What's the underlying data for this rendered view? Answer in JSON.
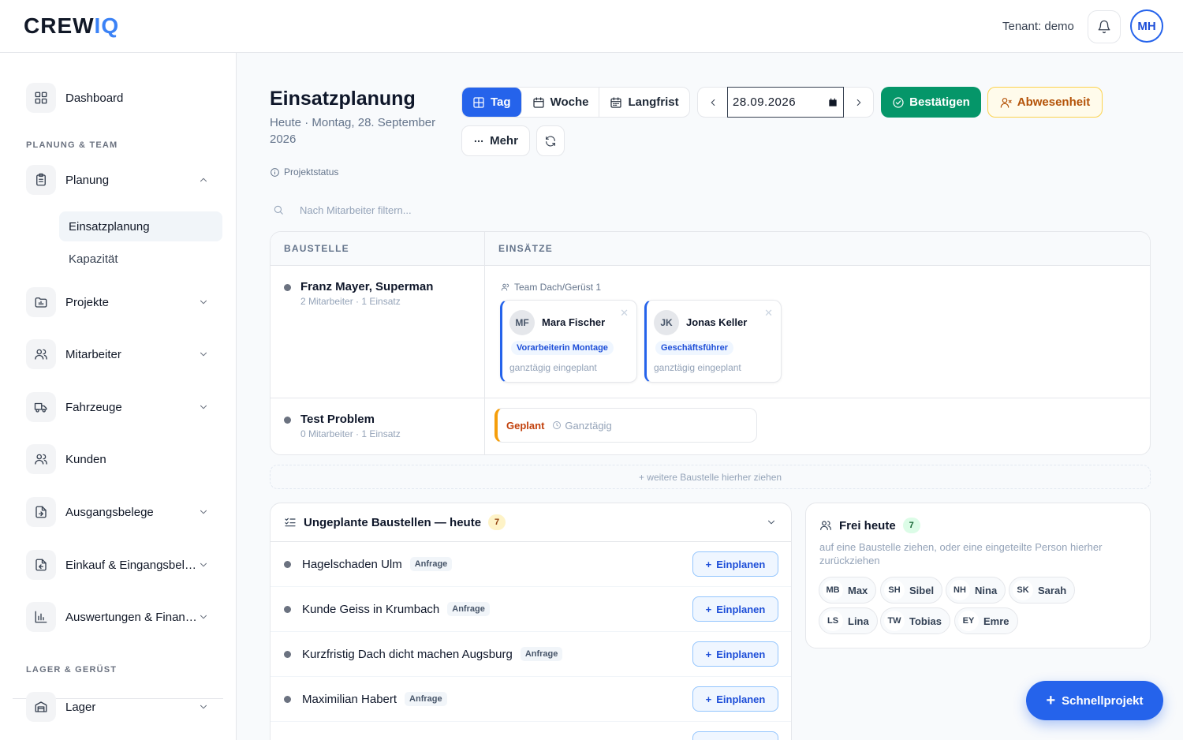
{
  "brand": {
    "logo_main": "CREW",
    "logo_accent": "IQ"
  },
  "header": {
    "tenant": "Tenant: demo",
    "avatar": "MH"
  },
  "sidebar": {
    "dashboard": "Dashboard",
    "section_planning": "PLANUNG & TEAM",
    "planung": "Planung",
    "sub_einsatzplanung": "Einsatzplanung",
    "sub_kapazitaet": "Kapazität",
    "projekte": "Projekte",
    "mitarbeiter": "Mitarbeiter",
    "fahrzeuge": "Fahrzeuge",
    "kunden": "Kunden",
    "ausgangsbelege": "Ausgangsbelege",
    "einkauf": "Einkauf & Eingangsbelege",
    "auswertungen": "Auswertungen & Finanzen",
    "section_lager": "LAGER & GERÜST",
    "lager": "Lager"
  },
  "page": {
    "title": "Einsatzplanung",
    "subtitle": "Heute · Montag, 28. September 2026",
    "project_status": "Projektstatus",
    "views": {
      "day": "Tag",
      "week": "Woche",
      "long": "Langfrist"
    },
    "date": "28.09.2026",
    "confirm": "Bestätigen",
    "absence": "Abwesenheit",
    "more": "Mehr",
    "filter_placeholder": "Nach Mitarbeiter filtern..."
  },
  "table": {
    "col_site": "BAUSTELLE",
    "col_assign": "EINSÄTZE",
    "rows": [
      {
        "name": "Franz Mayer, Superman",
        "meta": "2 Mitarbeiter · 1 Einsatz",
        "team": "Team Dach/Gerüst 1",
        "cards": [
          {
            "initials": "MF",
            "name": "Mara Fischer",
            "role": "Vorarbeiterin Montage",
            "status": "ganztägig eingeplant"
          },
          {
            "initials": "JK",
            "name": "Jonas Keller",
            "role": "Geschäftsführer",
            "status": "ganztägig eingeplant"
          }
        ]
      },
      {
        "name": "Test Problem",
        "meta": "0 Mitarbeiter · 1 Einsatz",
        "status": "Geplant",
        "time": "Ganztägig"
      }
    ],
    "drop_hint": "+ weitere Baustelle hierher ziehen"
  },
  "unplanned": {
    "title": "Ungeplante Baustellen — heute",
    "count": "7",
    "button": "Einplanen",
    "items": [
      {
        "name": "Hagelschaden Ulm",
        "tag": "Anfrage"
      },
      {
        "name": "Kunde Geiss in Krumbach",
        "tag": "Anfrage"
      },
      {
        "name": "Kurzfristig Dach dicht machen Augsburg",
        "tag": "Anfrage"
      },
      {
        "name": "Maximilian Habert",
        "tag": "Anfrage"
      }
    ]
  },
  "free": {
    "title": "Frei heute",
    "count": "7",
    "desc": "auf eine Baustelle ziehen, oder eine eingeteilte Person hierher zurückziehen",
    "people": [
      {
        "initials": "MB",
        "name": "Max"
      },
      {
        "initials": "SH",
        "name": "Sibel"
      },
      {
        "initials": "NH",
        "name": "Nina"
      },
      {
        "initials": "SK",
        "name": "Sarah"
      },
      {
        "initials": "LS",
        "name": "Lina"
      },
      {
        "initials": "TW",
        "name": "Tobias"
      },
      {
        "initials": "EY",
        "name": "Emre"
      }
    ]
  },
  "fab": "Schnellprojekt",
  "colors": {
    "primary": "#2563eb",
    "success": "#059669",
    "warning": "#f59e0b"
  }
}
